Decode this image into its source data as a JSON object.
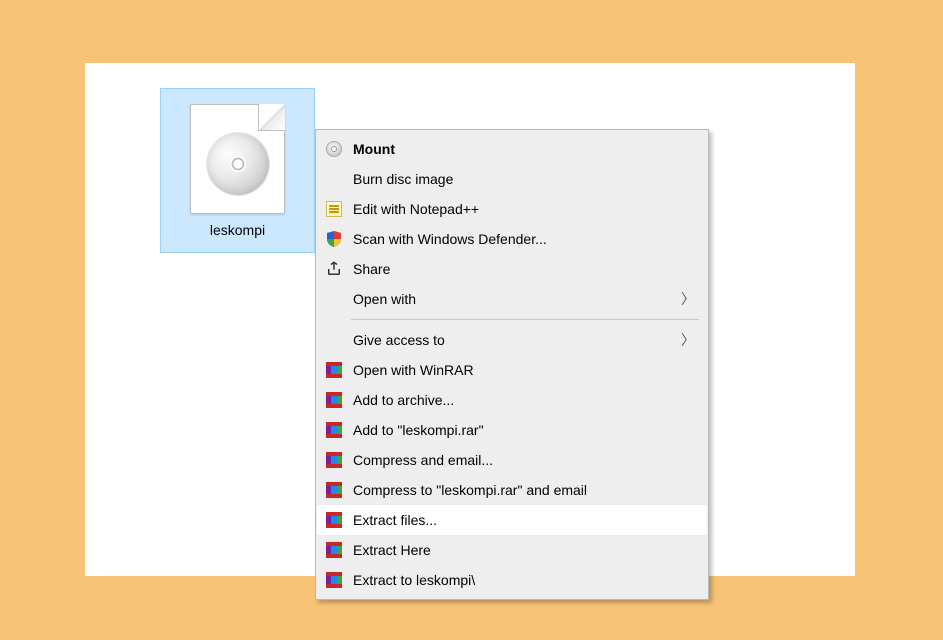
{
  "file": {
    "name": "leskompi",
    "icon": "disc-image-icon"
  },
  "menu": {
    "items": [
      {
        "label": "Mount",
        "bold": true,
        "icon": "disc-icon"
      },
      {
        "label": "Burn disc image",
        "icon": ""
      },
      {
        "label": "Edit with Notepad++",
        "icon": "notepad-plus-icon"
      },
      {
        "label": "Scan with Windows Defender...",
        "icon": "defender-shield-icon"
      },
      {
        "label": "Share",
        "icon": "share-icon"
      },
      {
        "label": "Open with",
        "submenu": true,
        "icon": ""
      },
      {
        "separator": true
      },
      {
        "label": "Give access to",
        "submenu": true,
        "icon": ""
      },
      {
        "label": "Open with WinRAR",
        "icon": "winrar-icon"
      },
      {
        "label": "Add to archive...",
        "icon": "winrar-icon"
      },
      {
        "label": "Add to \"leskompi.rar\"",
        "icon": "winrar-icon"
      },
      {
        "label": "Compress and email...",
        "icon": "winrar-icon"
      },
      {
        "label": "Compress to \"leskompi.rar\" and email",
        "icon": "winrar-icon"
      },
      {
        "label": "Extract files...",
        "hover": true,
        "icon": "winrar-icon"
      },
      {
        "label": "Extract Here",
        "icon": "winrar-icon"
      },
      {
        "label": "Extract to leskompi\\",
        "icon": "winrar-icon"
      }
    ]
  }
}
